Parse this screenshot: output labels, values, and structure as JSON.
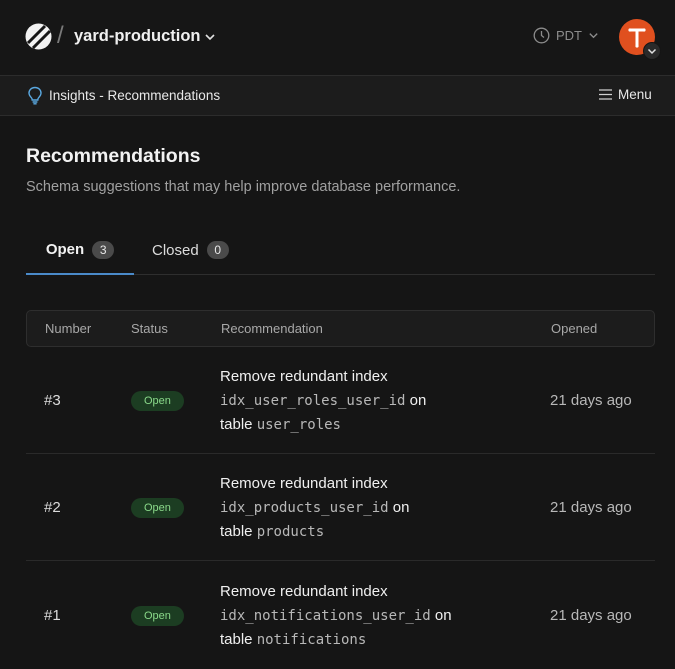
{
  "header": {
    "database_name": "yard-production",
    "timezone": "PDT",
    "avatar_initial": "T"
  },
  "subbar": {
    "breadcrumb": "Insights - Recommendations",
    "menu_label": "Menu"
  },
  "page": {
    "title": "Recommendations",
    "subtitle": "Schema suggestions that may help improve database performance."
  },
  "tabs": [
    {
      "label": "Open",
      "count": "3"
    },
    {
      "label": "Closed",
      "count": "0"
    }
  ],
  "table": {
    "columns": [
      "Number",
      "Status",
      "Recommendation",
      "Opened"
    ],
    "rows": [
      {
        "number": "#3",
        "status": "Open",
        "title": "Remove redundant index",
        "index": "idx_user_roles_user_id",
        "on": "on",
        "table_word": "table",
        "table_name": "user_roles",
        "opened": "21 days ago"
      },
      {
        "number": "#2",
        "status": "Open",
        "title": "Remove redundant index",
        "index": "idx_products_user_id",
        "on": "on",
        "table_word": "table",
        "table_name": "products",
        "opened": "21 days ago"
      },
      {
        "number": "#1",
        "status": "Open",
        "title": "Remove redundant index",
        "index": "idx_notifications_user_id",
        "on": "on",
        "table_word": "table",
        "table_name": "notifications",
        "opened": "21 days ago"
      }
    ]
  },
  "colors": {
    "accent": "#4a8ac9",
    "avatar": "#e0501f",
    "status_open_bg": "#1c3d22",
    "status_open_text": "#8ad98a"
  }
}
